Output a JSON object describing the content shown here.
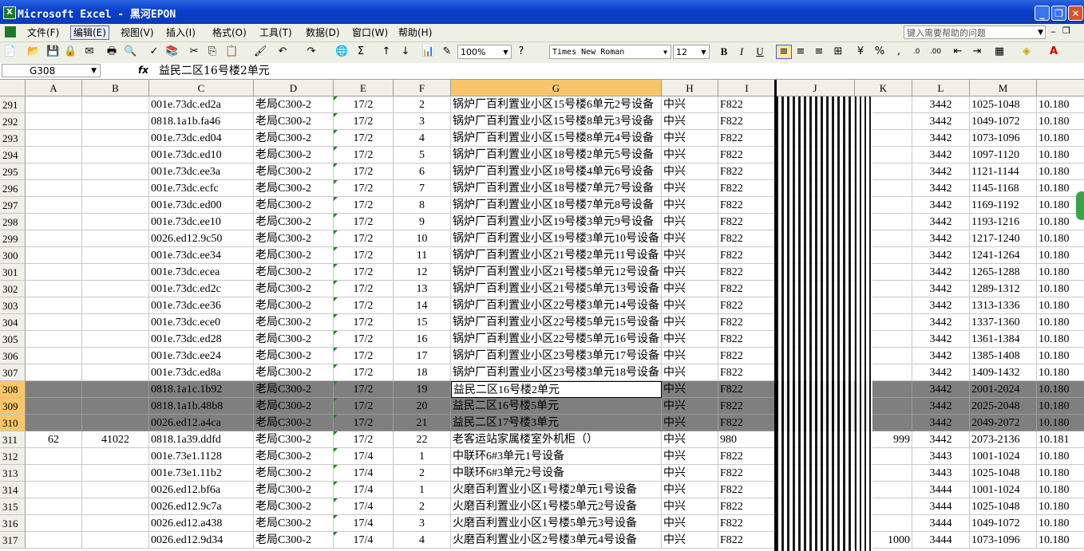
{
  "window": {
    "title": "Microsoft Excel - 黑河EPON",
    "min": "_",
    "max": "❐",
    "close": "✕"
  },
  "menu": {
    "items": [
      "文件(F)",
      "编辑(E)",
      "视图(V)",
      "插入(I)",
      "格式(O)",
      "工具(T)",
      "数据(D)",
      "窗口(W)",
      "帮助(H)"
    ],
    "active_index": 1,
    "help_placeholder": "键入需要帮助的问题"
  },
  "toolbar": {
    "zoom": "100%",
    "font_name": "Times New Roman",
    "font_size": "12",
    "bold": "B",
    "italic": "I",
    "underline": "U",
    "percent": "%",
    "comma": ","
  },
  "formula_bar": {
    "name_box": "G308",
    "fx": "fx",
    "content": "益民二区16号楼2单元"
  },
  "columns": [
    {
      "label": "A"
    },
    {
      "label": "B"
    },
    {
      "label": "C"
    },
    {
      "label": "D"
    },
    {
      "label": "E"
    },
    {
      "label": "F"
    },
    {
      "label": "G",
      "selected": true
    },
    {
      "label": "H"
    },
    {
      "label": "I"
    },
    {
      "label": "J"
    },
    {
      "label": "K"
    },
    {
      "label": "L"
    },
    {
      "label": "M"
    },
    {
      "label": ""
    }
  ],
  "rows": [
    {
      "n": "291",
      "a": "",
      "b": "",
      "c": "001e.73dc.ed2a",
      "d": "老局C300-2",
      "e": "17/2",
      "f": "2",
      "g": "锅炉厂百利置业小区15号楼6单元2号设备",
      "h": "中兴",
      "i": "F822",
      "k": "",
      "l": "3442",
      "m": "1025-1048",
      "n2": "10.180"
    },
    {
      "n": "292",
      "a": "",
      "b": "",
      "c": "0818.1a1b.fa46",
      "d": "老局C300-2",
      "e": "17/2",
      "f": "3",
      "g": "锅炉厂百利置业小区15号楼8单元3号设备",
      "h": "中兴",
      "i": "F822",
      "k": "",
      "l": "3442",
      "m": "1049-1072",
      "n2": "10.180"
    },
    {
      "n": "293",
      "a": "",
      "b": "",
      "c": "001e.73dc.ed04",
      "d": "老局C300-2",
      "e": "17/2",
      "f": "4",
      "g": "锅炉厂百利置业小区15号楼8单元4号设备",
      "h": "中兴",
      "i": "F822",
      "k": "",
      "l": "3442",
      "m": "1073-1096",
      "n2": "10.180"
    },
    {
      "n": "294",
      "a": "",
      "b": "",
      "c": "001e.73dc.ed10",
      "d": "老局C300-2",
      "e": "17/2",
      "f": "5",
      "g": "锅炉厂百利置业小区18号楼2单元5号设备",
      "h": "中兴",
      "i": "F822",
      "k": "",
      "l": "3442",
      "m": "1097-1120",
      "n2": "10.180"
    },
    {
      "n": "295",
      "a": "",
      "b": "",
      "c": "001e.73dc.ee3a",
      "d": "老局C300-2",
      "e": "17/2",
      "f": "6",
      "g": "锅炉厂百利置业小区18号楼4单元6号设备",
      "h": "中兴",
      "i": "F822",
      "k": "",
      "l": "3442",
      "m": "1121-1144",
      "n2": "10.180"
    },
    {
      "n": "296",
      "a": "",
      "b": "",
      "c": "001e.73dc.ecfc",
      "d": "老局C300-2",
      "e": "17/2",
      "f": "7",
      "g": "锅炉厂百利置业小区18号楼7单元7号设备",
      "h": "中兴",
      "i": "F822",
      "k": "",
      "l": "3442",
      "m": "1145-1168",
      "n2": "10.180"
    },
    {
      "n": "297",
      "a": "",
      "b": "",
      "c": "001e.73dc.ed00",
      "d": "老局C300-2",
      "e": "17/2",
      "f": "8",
      "g": "锅炉厂百利置业小区18号楼7单元8号设备",
      "h": "中兴",
      "i": "F822",
      "k": "",
      "l": "3442",
      "m": "1169-1192",
      "n2": "10.180"
    },
    {
      "n": "298",
      "a": "",
      "b": "",
      "c": "001e.73dc.ee10",
      "d": "老局C300-2",
      "e": "17/2",
      "f": "9",
      "g": "锅炉厂百利置业小区19号楼3单元9号设备",
      "h": "中兴",
      "i": "F822",
      "k": "",
      "l": "3442",
      "m": "1193-1216",
      "n2": "10.180"
    },
    {
      "n": "299",
      "a": "",
      "b": "",
      "c": "0026.ed12.9c50",
      "d": "老局C300-2",
      "e": "17/2",
      "f": "10",
      "g": "锅炉厂百利置业小区19号楼3单元10号设备",
      "h": "中兴",
      "i": "F822",
      "k": "",
      "l": "3442",
      "m": "1217-1240",
      "n2": "10.180"
    },
    {
      "n": "300",
      "a": "",
      "b": "",
      "c": "001e.73dc.ee34",
      "d": "老局C300-2",
      "e": "17/2",
      "f": "11",
      "g": "锅炉厂百利置业小区21号楼2单元11号设备",
      "h": "中兴",
      "i": "F822",
      "k": "",
      "l": "3442",
      "m": "1241-1264",
      "n2": "10.180"
    },
    {
      "n": "301",
      "a": "",
      "b": "",
      "c": "001e.73dc.ecea",
      "d": "老局C300-2",
      "e": "17/2",
      "f": "12",
      "g": "锅炉厂百利置业小区21号楼5单元12号设备",
      "h": "中兴",
      "i": "F822",
      "k": "",
      "l": "3442",
      "m": "1265-1288",
      "n2": "10.180"
    },
    {
      "n": "302",
      "a": "",
      "b": "",
      "c": "001e.73dc.ed2c",
      "d": "老局C300-2",
      "e": "17/2",
      "f": "13",
      "g": "锅炉厂百利置业小区21号楼5单元13号设备",
      "h": "中兴",
      "i": "F822",
      "k": "",
      "l": "3442",
      "m": "1289-1312",
      "n2": "10.180"
    },
    {
      "n": "303",
      "a": "",
      "b": "",
      "c": "001e.73dc.ee36",
      "d": "老局C300-2",
      "e": "17/2",
      "f": "14",
      "g": "锅炉厂百利置业小区22号楼3单元14号设备",
      "h": "中兴",
      "i": "F822",
      "k": "",
      "l": "3442",
      "m": "1313-1336",
      "n2": "10.180"
    },
    {
      "n": "304",
      "a": "",
      "b": "",
      "c": "001e.73dc.ece0",
      "d": "老局C300-2",
      "e": "17/2",
      "f": "15",
      "g": "锅炉厂百利置业小区22号楼5单元15号设备",
      "h": "中兴",
      "i": "F822",
      "k": "",
      "l": "3442",
      "m": "1337-1360",
      "n2": "10.180"
    },
    {
      "n": "305",
      "a": "",
      "b": "",
      "c": "001e.73dc.ed28",
      "d": "老局C300-2",
      "e": "17/2",
      "f": "16",
      "g": "锅炉厂百利置业小区22号楼5单元16号设备",
      "h": "中兴",
      "i": "F822",
      "k": "",
      "l": "3442",
      "m": "1361-1384",
      "n2": "10.180"
    },
    {
      "n": "306",
      "a": "",
      "b": "",
      "c": "001e.73dc.ee24",
      "d": "老局C300-2",
      "e": "17/2",
      "f": "17",
      "g": "锅炉厂百利置业小区23号楼3单元17号设备",
      "h": "中兴",
      "i": "F822",
      "k": "",
      "l": "3442",
      "m": "1385-1408",
      "n2": "10.180"
    },
    {
      "n": "307",
      "a": "",
      "b": "",
      "c": "001e.73dc.ed8a",
      "d": "老局C300-2",
      "e": "17/2",
      "f": "18",
      "g": "锅炉厂百利置业小区23号楼3单元18号设备",
      "h": "中兴",
      "i": "F822",
      "k": "",
      "l": "3442",
      "m": "1409-1432",
      "n2": "10.180"
    },
    {
      "n": "308",
      "a": "",
      "b": "",
      "c": "0818.1a1c.1b92",
      "d": "老局C300-2",
      "e": "17/2",
      "f": "19",
      "g": "益民二区16号楼2单元",
      "h": "中兴",
      "i": "F822",
      "k": "",
      "l": "3442",
      "m": "2001-2024",
      "n2": "10.180",
      "hl": true,
      "active": true
    },
    {
      "n": "309",
      "a": "",
      "b": "",
      "c": "0818.1a1b.48b8",
      "d": "老局C300-2",
      "e": "17/2",
      "f": "20",
      "g": "益民二区16号楼5单元",
      "h": "中兴",
      "i": "F822",
      "k": "",
      "l": "3442",
      "m": "2025-2048",
      "n2": "10.180",
      "hl": true
    },
    {
      "n": "310",
      "a": "",
      "b": "",
      "c": "0026.ed12.a4ca",
      "d": "老局C300-2",
      "e": "17/2",
      "f": "21",
      "g": "益民二区17号楼3单元",
      "h": "中兴",
      "i": "F822",
      "k": "",
      "l": "3442",
      "m": "2049-2072",
      "n2": "10.180",
      "hl": true
    },
    {
      "n": "311",
      "a": "62",
      "b": "41022",
      "c": "0818.1a39.ddfd",
      "d": "老局C300-2",
      "e": "17/2",
      "f": "22",
      "g": "老客运站家属楼室外机柜（）",
      "h": "中兴",
      "i": "980",
      "k": "999",
      "l": "3442",
      "m": "2073-2136",
      "n2": "10.181"
    },
    {
      "n": "312",
      "a": "",
      "b": "",
      "c": "001e.73e1.1128",
      "d": "老局C300-2",
      "e": "17/4",
      "f": "1",
      "g": "中联环6#3单元1号设备",
      "h": "中兴",
      "i": "F822",
      "k": "",
      "l": "3443",
      "m": "1001-1024",
      "n2": "10.180"
    },
    {
      "n": "313",
      "a": "",
      "b": "",
      "c": "001e.73e1.11b2",
      "d": "老局C300-2",
      "e": "17/4",
      "f": "2",
      "g": "中联环6#3单元2号设备",
      "h": "中兴",
      "i": "F822",
      "k": "",
      "l": "3443",
      "m": "1025-1048",
      "n2": "10.180"
    },
    {
      "n": "314",
      "a": "",
      "b": "",
      "c": "0026.ed12.bf6a",
      "d": "老局C300-2",
      "e": "17/4",
      "f": "1",
      "g": "火磨百利置业小区1号楼2单元1号设备",
      "h": "中兴",
      "i": "F822",
      "k": "",
      "l": "3444",
      "m": "1001-1024",
      "n2": "10.180"
    },
    {
      "n": "315",
      "a": "",
      "b": "",
      "c": "0026.ed12.9c7a",
      "d": "老局C300-2",
      "e": "17/4",
      "f": "2",
      "g": "火磨百利置业小区1号楼5单元2号设备",
      "h": "中兴",
      "i": "F822",
      "k": "",
      "l": "3444",
      "m": "1025-1048",
      "n2": "10.180"
    },
    {
      "n": "316",
      "a": "",
      "b": "",
      "c": "0026.ed12.a438",
      "d": "老局C300-2",
      "e": "17/4",
      "f": "3",
      "g": "火磨百利置业小区1号楼5单元3号设备",
      "h": "中兴",
      "i": "F822",
      "k": "",
      "l": "3444",
      "m": "1049-1072",
      "n2": "10.180"
    },
    {
      "n": "317",
      "a": "",
      "b": "",
      "c": "0026.ed12.9d34",
      "d": "老局C300-2",
      "e": "17/4",
      "f": "4",
      "g": "火磨百利置业小区2号楼3单元4号设备",
      "h": "中兴",
      "i": "F822",
      "k": "1000",
      "l": "3444",
      "m": "1073-1096",
      "n2": "10.180"
    }
  ],
  "colors": {
    "title_blue": "#0a3fcc",
    "header_bg": "#f0f0e8",
    "selected_header": "#f8c66a",
    "highlight_rows": "#7f7f7f"
  }
}
